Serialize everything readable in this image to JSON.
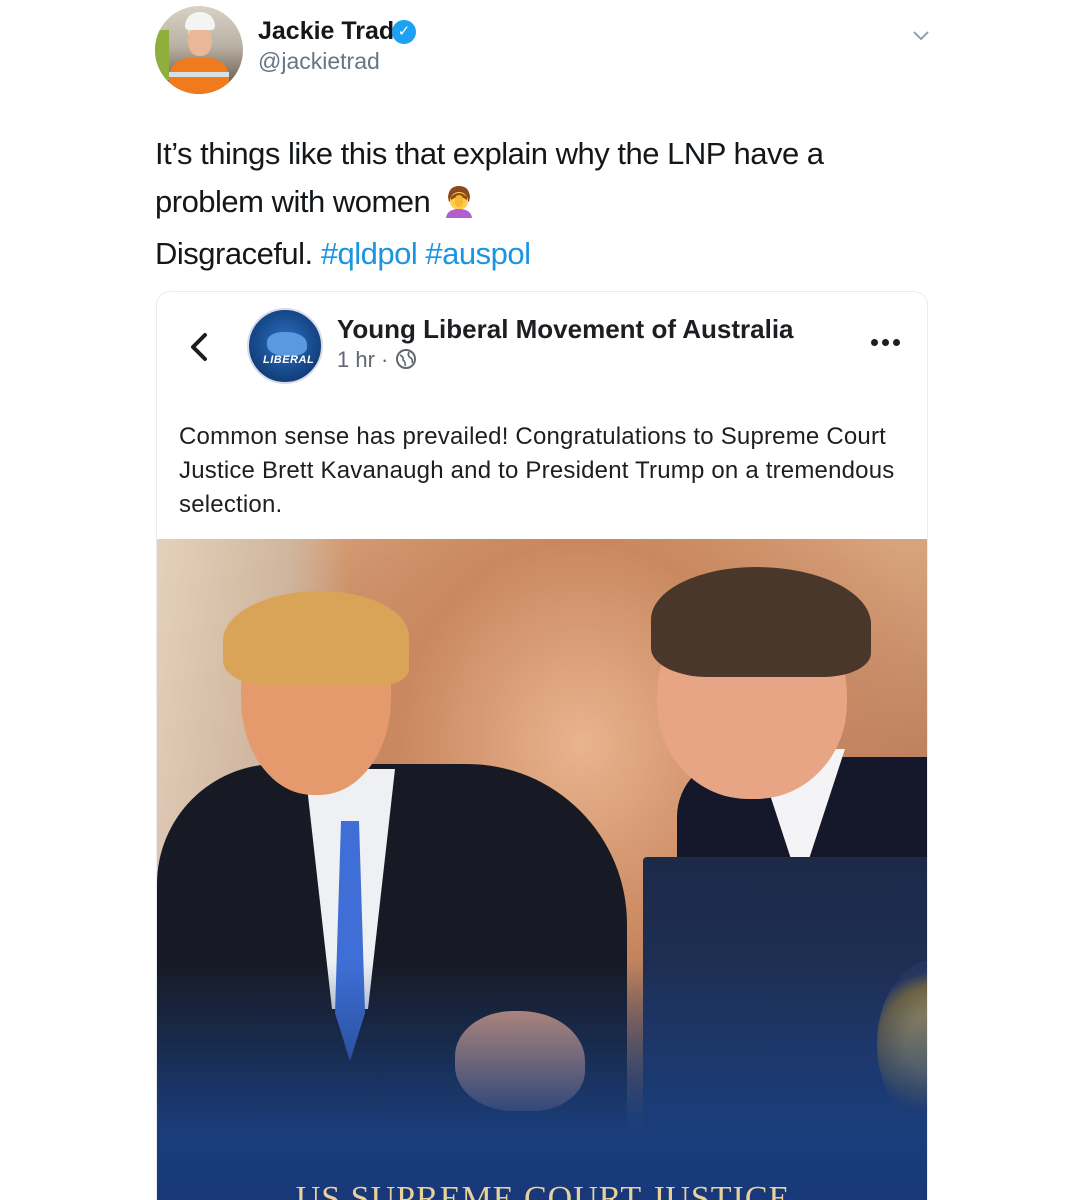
{
  "tweet": {
    "author_name": "Jackie Trad",
    "author_handle": "@jackietrad",
    "text_line1": "It’s things like this that explain why the LNP have a problem with women",
    "text_line2_prefix": "Disgraceful.",
    "hashtags": [
      "#qldpol",
      "#auspol"
    ]
  },
  "embedded_post": {
    "page_name": "Young Liberal Movement of Australia",
    "logo_text": "LIBERAL",
    "time": "1 hr ·",
    "body": "Common sense has prevailed! Congratulations to Supreme Court Justice Brett Kavanaugh and to President Trump on a tremendous selection.",
    "image_caption": "US SUPREME COURT JUSTICE"
  },
  "colors": {
    "hashtag": "#1b95e0",
    "verified": "#1da1f2",
    "caption_gold": "#e9d29a"
  },
  "icons": [
    "verified-badge-icon",
    "chevron-down-icon",
    "face-palm-emoji-icon",
    "back-arrow-icon",
    "globe-icon",
    "more-options-icon"
  ]
}
